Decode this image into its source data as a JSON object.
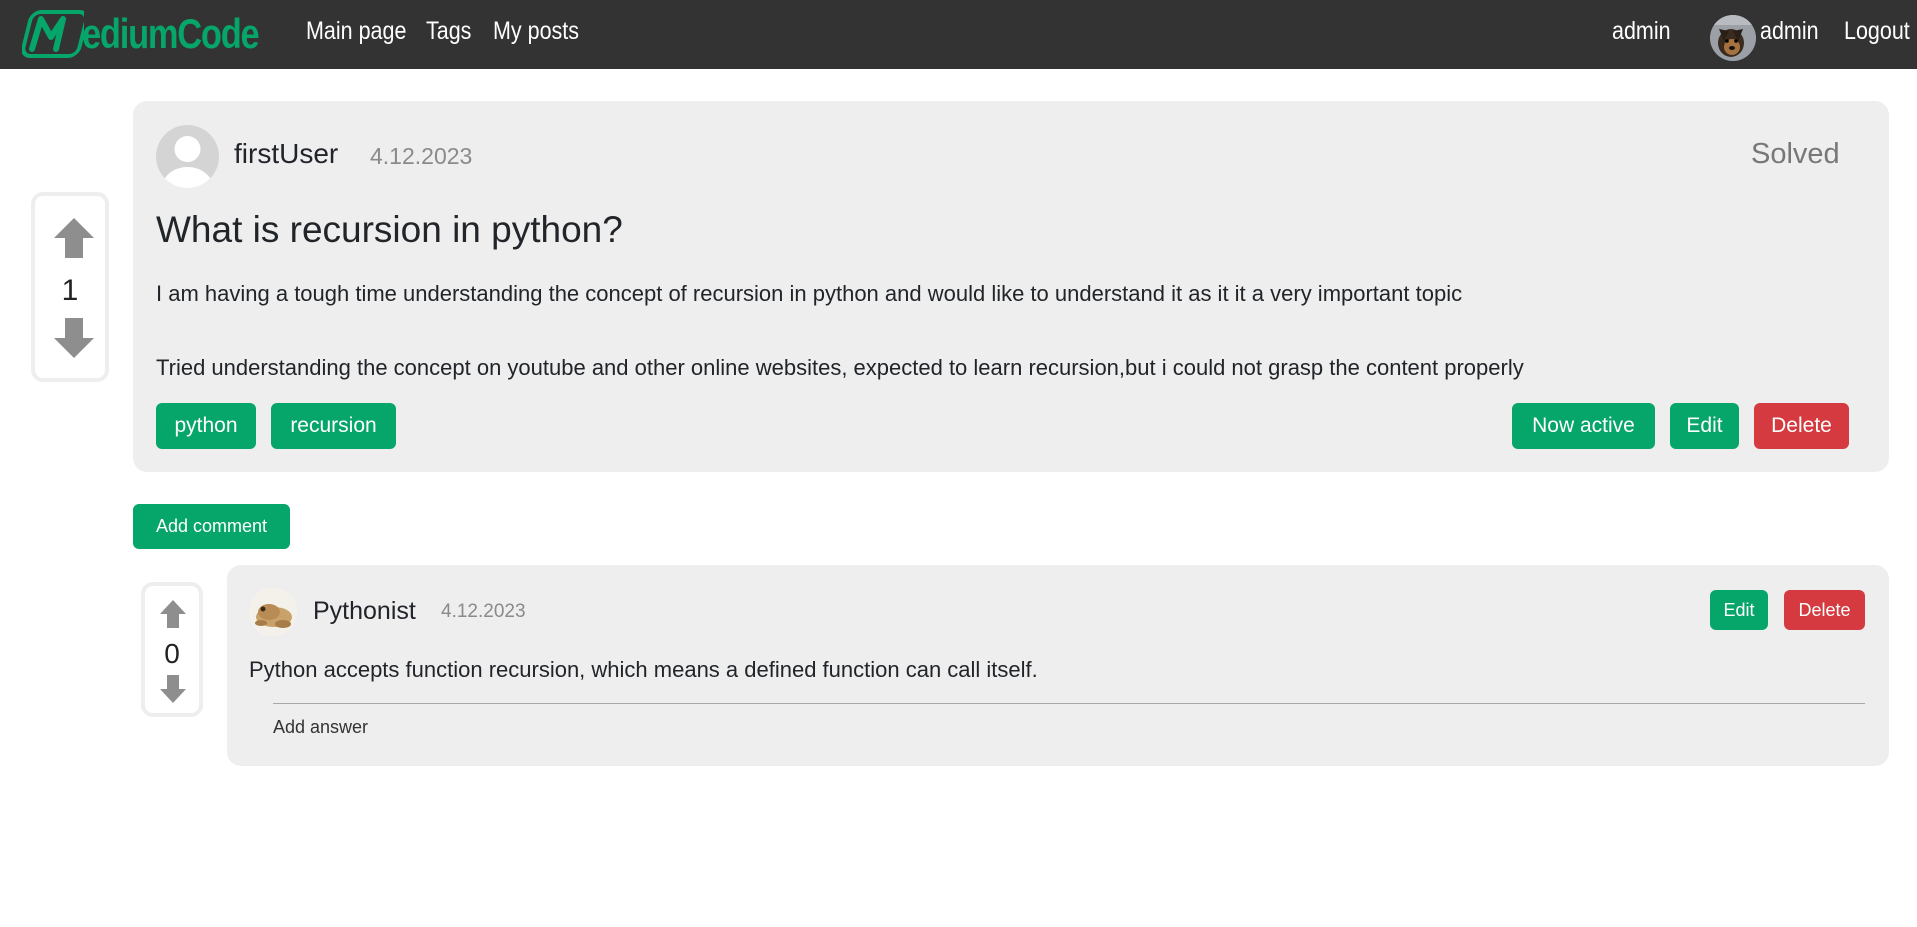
{
  "navbar": {
    "logo_text": "ediumCode",
    "links": [
      "Main page",
      "Tags",
      "My posts"
    ],
    "user_label": "admin",
    "profile_name": "admin",
    "logout_label": "Logout"
  },
  "post": {
    "votes": "1",
    "author": "firstUser",
    "date": "4.12.2023",
    "status": "Solved",
    "title": "What is recursion in python?",
    "paragraphs": [
      "I am having a tough time understanding the concept of recursion in python and would like to understand it as it it a very important topic",
      "Tried understanding the concept on youtube and other online websites, expected to learn recursion,but i could not grasp the content properly"
    ],
    "tags": [
      "python",
      "recursion"
    ],
    "actions": {
      "active_label": "Now active",
      "edit_label": "Edit",
      "delete_label": "Delete"
    }
  },
  "add_comment_label": "Add comment",
  "comment": {
    "votes": "0",
    "author": "Pythonist",
    "date": "4.12.2023",
    "text": "Python accepts function recursion, which means a defined function can call itself.",
    "edit_label": "Edit",
    "delete_label": "Delete",
    "add_answer_label": "Add answer"
  },
  "colors": {
    "navbar": "#333333",
    "accent_green": "#06a56a",
    "danger_red": "#d43a3f",
    "card_bg": "#eeeeee"
  },
  "icons": [
    "logo-m-icon",
    "vote-up-icon",
    "vote-down-icon",
    "user-avatar-icon",
    "frog-avatar-icon",
    "dog-avatar-icon"
  ]
}
